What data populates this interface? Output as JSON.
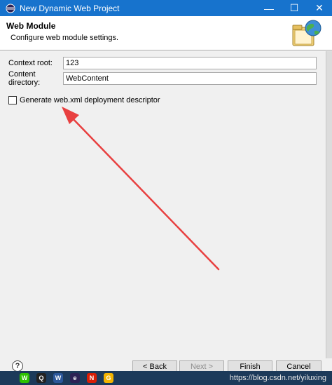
{
  "window": {
    "title": "New Dynamic Web Project",
    "minimize_label": "—",
    "maximize_label": "☐",
    "close_label": "✕"
  },
  "header": {
    "title": "Web Module",
    "description": "Configure web module settings."
  },
  "form": {
    "context_root_label": "Context root:",
    "context_root_value": "123",
    "content_directory_label": "Content directory:",
    "content_directory_value": "WebContent",
    "generate_label": "Generate web.xml deployment descriptor",
    "generate_checked": false
  },
  "buttons": {
    "help_label": "?",
    "back_label": "< Back",
    "next_label": "Next >",
    "finish_label": "Finish",
    "cancel_label": "Cancel"
  },
  "annotation": {
    "arrow_color": "#e84040"
  },
  "taskbar": {
    "watermark": "https://blog.csdn.net/yiluxing",
    "icons": [
      "wechat-icon",
      "penguin-icon",
      "word-icon",
      "eclipse-icon",
      "netease-music-icon",
      "g-icon"
    ]
  },
  "colors": {
    "titlebar": "#1773cd",
    "dialog_bg": "#f0f0f0",
    "taskbar": "#1c3a5a"
  }
}
